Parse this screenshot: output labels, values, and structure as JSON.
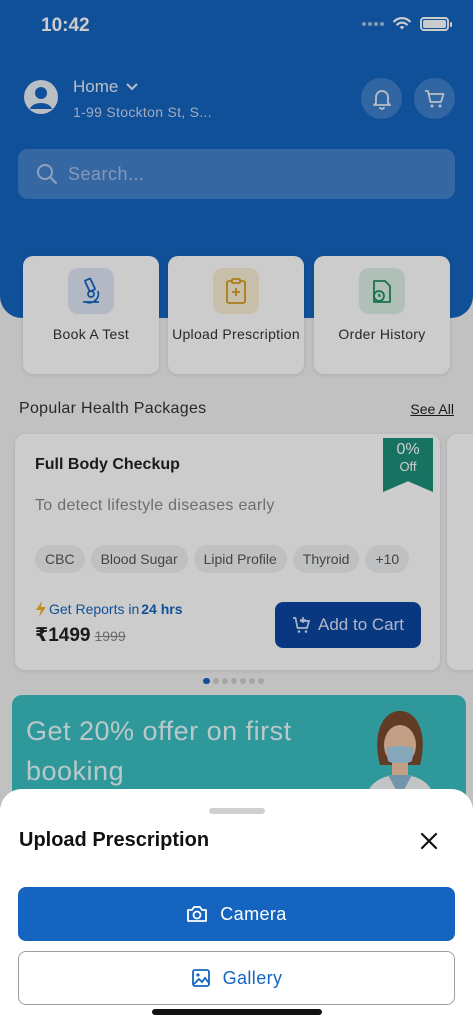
{
  "status_bar": {
    "time": "10:42"
  },
  "header": {
    "location_title": "Home",
    "location_address": "1-99 Stockton St, S...",
    "search_placeholder": "Search..."
  },
  "quick_actions": [
    {
      "label": "Book A Test",
      "icon": "microscope-icon"
    },
    {
      "label": "Upload Prescription",
      "icon": "clipboard-plus-icon"
    },
    {
      "label": "Order History",
      "icon": "order-history-icon"
    }
  ],
  "packages_section": {
    "title": "Popular Health Packages",
    "see_all": "See All",
    "package": {
      "name": "Full Body Checkup",
      "description": "To detect lifestyle diseases early",
      "discount_pct": "0%",
      "discount_off": "Off",
      "tests": [
        "CBC",
        "Blood Sugar",
        "Lipid Profile",
        "Thyroid",
        "+10"
      ],
      "reports_text": "Get Reports in",
      "reports_time": "24 hrs",
      "price": "₹1499",
      "old_price": "1999",
      "add_to_cart": "Add to Cart"
    },
    "pager_count": 7,
    "pager_active": 0
  },
  "banner": {
    "text": "Get 20% offer on first booking"
  },
  "bottom_sheet": {
    "title": "Upload Prescription",
    "camera_label": "Camera",
    "gallery_label": "Gallery"
  },
  "colors": {
    "primary": "#1565c0",
    "ribbon": "#1f8f7a",
    "banner": "#3bbfc1"
  }
}
